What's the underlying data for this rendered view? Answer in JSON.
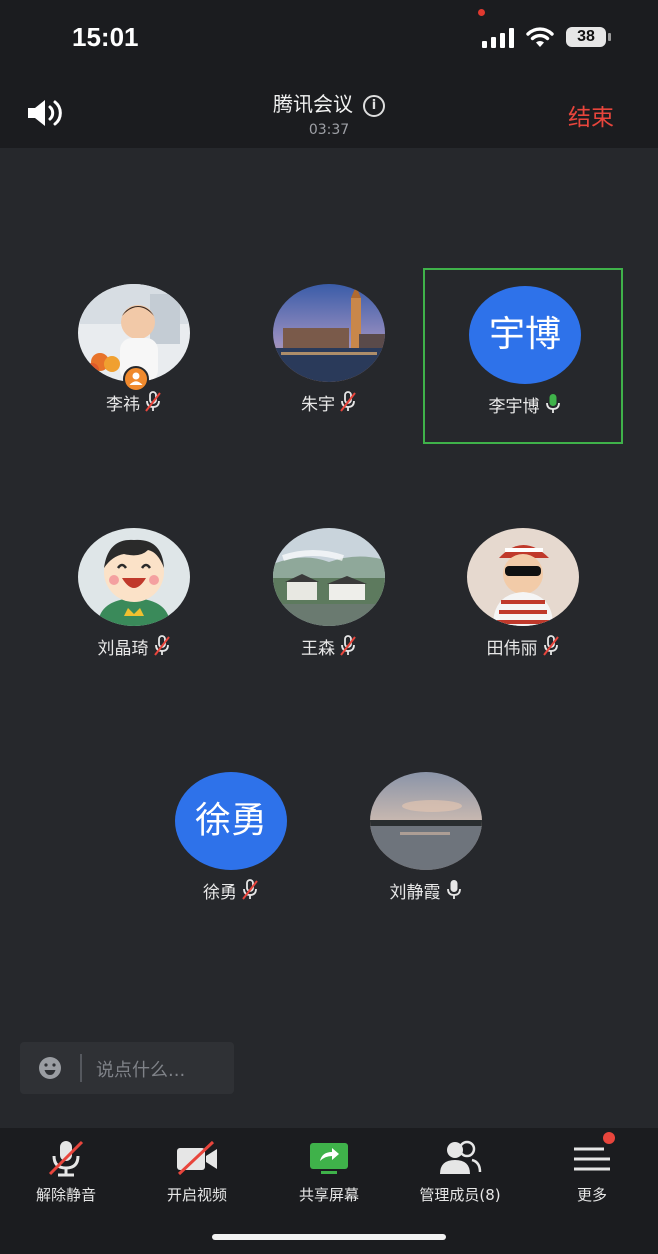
{
  "status_bar": {
    "time": "15:01",
    "battery": "38"
  },
  "header": {
    "title": "腾讯会议",
    "timer": "03:37",
    "end_label": "结束"
  },
  "participants": [
    {
      "name": "李祎",
      "mic": "muted",
      "avatar": "photo-baby",
      "host": true
    },
    {
      "name": "朱宇",
      "mic": "muted",
      "avatar": "photo-city"
    },
    {
      "name": "李宇博",
      "mic": "speaking",
      "avatar_text": "宇博",
      "active_speaker": true
    },
    {
      "name": "刘晶琦",
      "mic": "muted",
      "avatar": "cartoon-boy"
    },
    {
      "name": "王森",
      "mic": "muted",
      "avatar": "photo-village"
    },
    {
      "name": "田伟丽",
      "mic": "muted",
      "avatar": "photo-baby-sunglasses"
    },
    {
      "name": "徐勇",
      "mic": "muted",
      "avatar_text": "徐勇"
    },
    {
      "name": "刘静霞",
      "mic": "on",
      "avatar": "photo-lake-sunset"
    }
  ],
  "chat": {
    "placeholder": "说点什么..."
  },
  "toolbar": [
    {
      "label": "解除静音",
      "icon": "mic-muted-icon"
    },
    {
      "label": "开启视频",
      "icon": "video-off-icon"
    },
    {
      "label": "共享屏幕",
      "icon": "share-screen-icon"
    },
    {
      "label": "管理成员(8)",
      "icon": "members-icon"
    },
    {
      "label": "更多",
      "icon": "more-icon"
    }
  ],
  "colors": {
    "accent_blue": "#2e72ea",
    "end_red": "#e8453c",
    "speaking_green": "#3fb24a"
  }
}
